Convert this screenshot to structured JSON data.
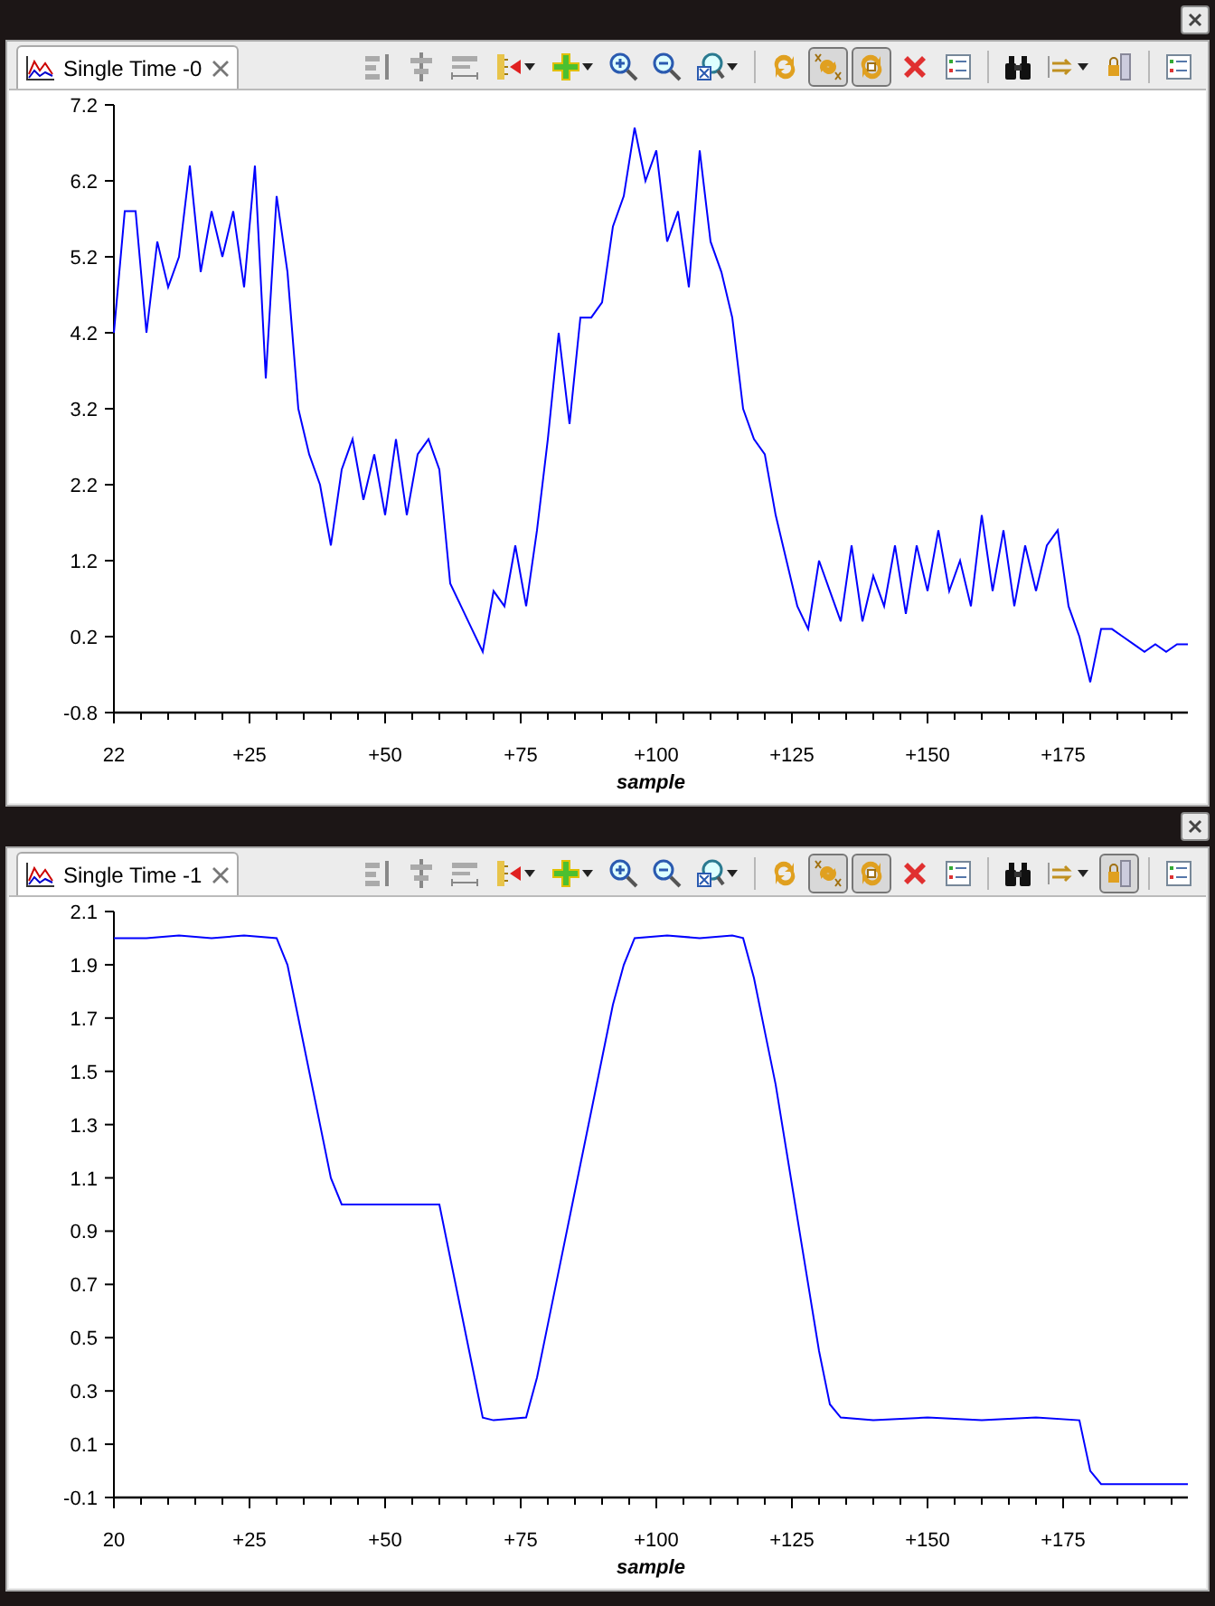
{
  "panels": [
    {
      "tab": {
        "title": "Single Time -0",
        "selected": true
      },
      "toolbar": [
        {
          "pressed": false
        },
        {
          "pressed": false
        },
        {
          "pressed": false
        },
        {
          "pressed": false
        },
        {
          "pressed": false
        },
        {
          "pressed": false
        },
        {
          "pressed": false
        },
        {
          "pressed": false
        },
        {
          "pressed": false
        },
        {
          "pressed": true
        },
        {
          "pressed": true
        },
        {
          "pressed": false
        },
        {
          "pressed": false
        },
        {
          "pressed": false
        },
        {
          "pressed": false
        },
        {
          "pressed": false
        },
        {
          "pressed": false
        }
      ],
      "x_axis_start": "22",
      "chart_data": {
        "type": "line",
        "xlabel": "sample",
        "xlim": [
          0,
          198
        ],
        "ylim": [
          -0.8,
          7.2
        ],
        "xticks": [
          {
            "value": 25,
            "label": "+25"
          },
          {
            "value": 50,
            "label": "+50"
          },
          {
            "value": 75,
            "label": "+75"
          },
          {
            "value": 100,
            "label": "+100"
          },
          {
            "value": 125,
            "label": "+125"
          },
          {
            "value": 150,
            "label": "+150"
          },
          {
            "value": 175,
            "label": "+175"
          }
        ],
        "yticks": [
          -0.8,
          0.2,
          1.2,
          2.2,
          3.2,
          4.2,
          5.2,
          6.2,
          7.2
        ],
        "x": [
          0,
          2,
          4,
          6,
          8,
          10,
          12,
          14,
          16,
          18,
          20,
          22,
          24,
          26,
          28,
          30,
          32,
          34,
          36,
          38,
          40,
          42,
          44,
          46,
          48,
          50,
          52,
          54,
          56,
          58,
          60,
          62,
          64,
          66,
          68,
          70,
          72,
          74,
          76,
          78,
          80,
          82,
          84,
          86,
          88,
          90,
          92,
          94,
          96,
          98,
          100,
          102,
          104,
          106,
          108,
          110,
          112,
          114,
          116,
          118,
          120,
          122,
          124,
          126,
          128,
          130,
          132,
          134,
          136,
          138,
          140,
          142,
          144,
          146,
          148,
          150,
          152,
          154,
          156,
          158,
          160,
          162,
          164,
          166,
          168,
          170,
          172,
          174,
          176,
          178,
          180,
          182,
          184,
          186,
          188,
          190,
          192,
          194,
          196,
          198
        ],
        "series": [
          {
            "color": "#0000ff",
            "values": [
              4.2,
              5.8,
              5.8,
              4.2,
              5.4,
              4.8,
              5.2,
              6.4,
              5.0,
              5.8,
              5.2,
              5.8,
              4.8,
              6.4,
              3.6,
              6.0,
              5.0,
              3.2,
              2.6,
              2.2,
              1.4,
              2.4,
              2.8,
              2.0,
              2.6,
              1.8,
              2.8,
              1.8,
              2.6,
              2.8,
              2.4,
              0.9,
              0.6,
              0.3,
              0.0,
              0.8,
              0.6,
              1.4,
              0.6,
              1.6,
              2.8,
              4.2,
              3.0,
              4.4,
              4.4,
              4.6,
              5.6,
              6.0,
              6.9,
              6.2,
              6.6,
              5.4,
              5.8,
              4.8,
              6.6,
              5.4,
              5.0,
              4.4,
              3.2,
              2.8,
              2.6,
              1.8,
              1.2,
              0.6,
              0.3,
              1.2,
              0.8,
              0.4,
              1.4,
              0.4,
              1.0,
              0.6,
              1.4,
              0.5,
              1.4,
              0.8,
              1.6,
              0.8,
              1.2,
              0.6,
              1.8,
              0.8,
              1.6,
              0.6,
              1.4,
              0.8,
              1.4,
              1.6,
              0.6,
              0.2,
              -0.4,
              0.3,
              0.3,
              0.2,
              0.1,
              0.0,
              0.1,
              0.0,
              0.1,
              0.1
            ]
          }
        ]
      }
    },
    {
      "tab": {
        "title": "Single Time -1",
        "selected": true
      },
      "toolbar": [
        {
          "pressed": false
        },
        {
          "pressed": false
        },
        {
          "pressed": false
        },
        {
          "pressed": false
        },
        {
          "pressed": false
        },
        {
          "pressed": false
        },
        {
          "pressed": false
        },
        {
          "pressed": false
        },
        {
          "pressed": false
        },
        {
          "pressed": true
        },
        {
          "pressed": true
        },
        {
          "pressed": false
        },
        {
          "pressed": false
        },
        {
          "pressed": false
        },
        {
          "pressed": false
        },
        {
          "pressed": true
        },
        {
          "pressed": false
        }
      ],
      "x_axis_start": "20",
      "chart_data": {
        "type": "line",
        "xlabel": "sample",
        "xlim": [
          0,
          198
        ],
        "ylim": [
          -0.1,
          2.1
        ],
        "xticks": [
          {
            "value": 25,
            "label": "+25"
          },
          {
            "value": 50,
            "label": "+50"
          },
          {
            "value": 75,
            "label": "+75"
          },
          {
            "value": 100,
            "label": "+100"
          },
          {
            "value": 125,
            "label": "+125"
          },
          {
            "value": 150,
            "label": "+150"
          },
          {
            "value": 175,
            "label": "+175"
          }
        ],
        "yticks": [
          -0.1,
          0.1,
          0.3,
          0.5,
          0.7,
          0.9,
          1.1,
          1.3,
          1.5,
          1.7,
          1.9,
          2.1
        ],
        "x": [
          0,
          6,
          12,
          18,
          24,
          30,
          32,
          34,
          36,
          38,
          40,
          42,
          48,
          54,
          60,
          62,
          64,
          66,
          68,
          70,
          76,
          78,
          80,
          82,
          84,
          86,
          88,
          90,
          92,
          94,
          96,
          102,
          108,
          114,
          116,
          118,
          120,
          122,
          124,
          126,
          128,
          130,
          132,
          134,
          140,
          150,
          160,
          170,
          178,
          180,
          182,
          190,
          198
        ],
        "series": [
          {
            "color": "#0000ff",
            "values": [
              2.0,
              2.0,
              2.01,
              2.0,
              2.01,
              2.0,
              1.9,
              1.7,
              1.5,
              1.3,
              1.1,
              1.0,
              1.0,
              1.0,
              1.0,
              0.8,
              0.6,
              0.4,
              0.2,
              0.19,
              0.2,
              0.35,
              0.55,
              0.75,
              0.95,
              1.15,
              1.35,
              1.55,
              1.75,
              1.9,
              2.0,
              2.01,
              2.0,
              2.01,
              2.0,
              1.85,
              1.65,
              1.45,
              1.2,
              0.95,
              0.7,
              0.45,
              0.25,
              0.2,
              0.19,
              0.2,
              0.19,
              0.2,
              0.19,
              0.0,
              -0.05,
              -0.05,
              -0.05
            ]
          }
        ]
      }
    }
  ]
}
